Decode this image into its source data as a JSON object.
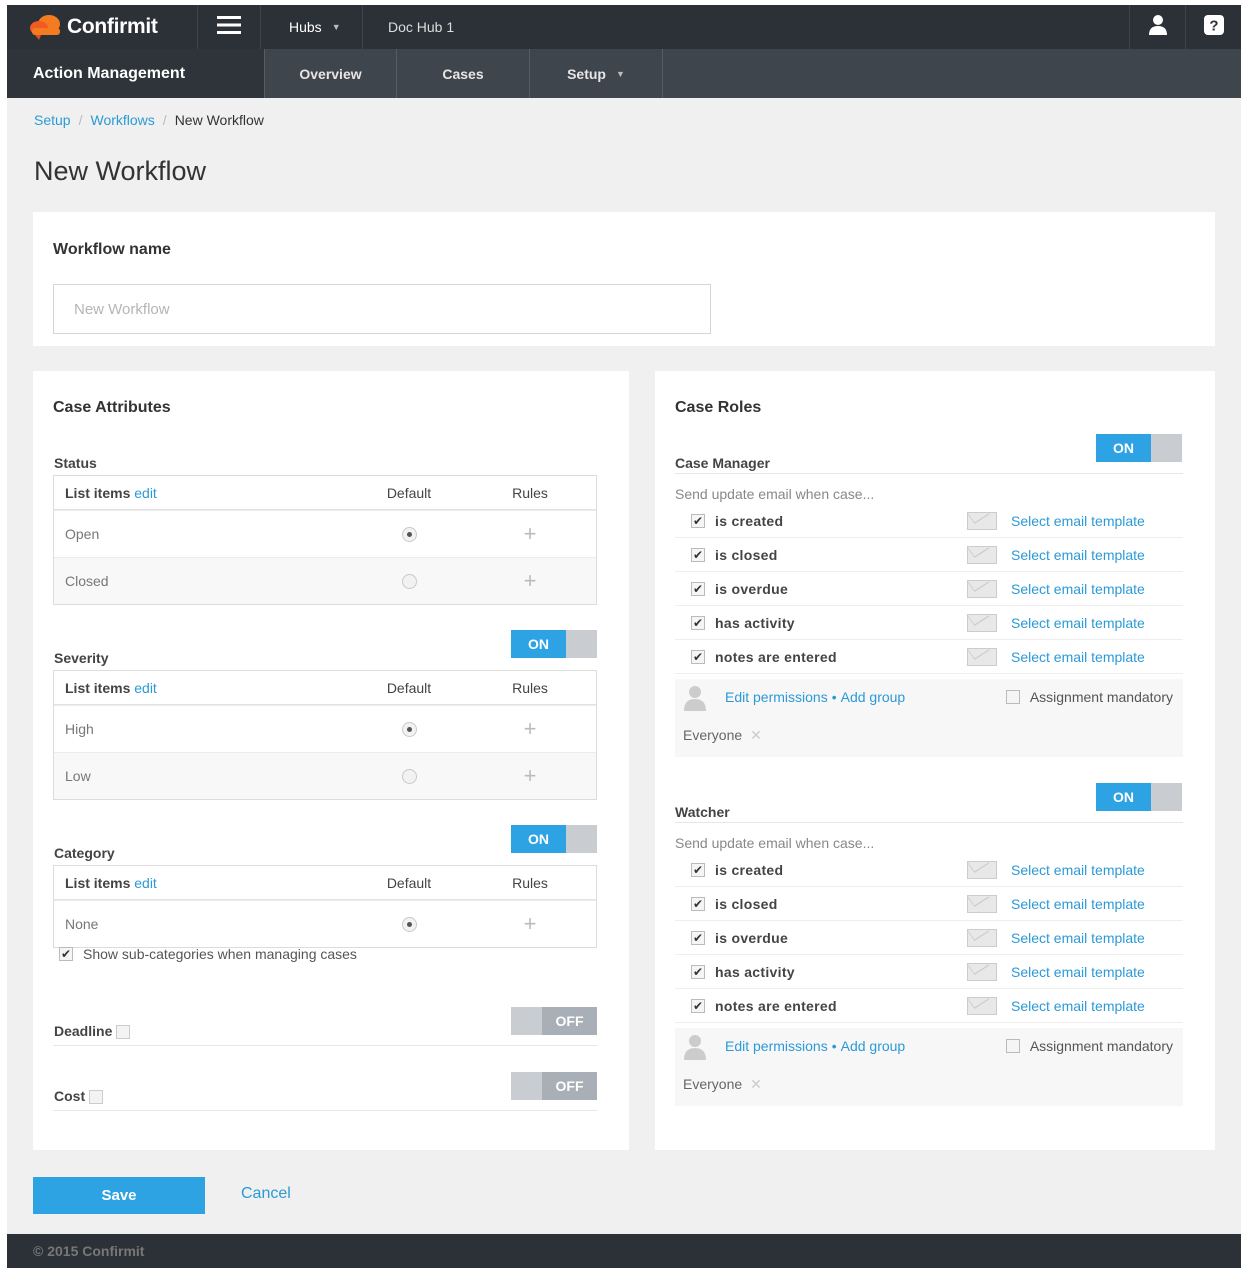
{
  "header": {
    "brand": "Confirmit",
    "hubs_label": "Hubs",
    "hub_name": "Doc Hub 1"
  },
  "subnav": {
    "title": "Action Management",
    "tabs": [
      {
        "label": "Overview"
      },
      {
        "label": "Cases"
      },
      {
        "label": "Setup"
      }
    ]
  },
  "breadcrumb": [
    "Setup",
    "Workflows",
    "New Workflow"
  ],
  "page_title": "New Workflow",
  "workflow_name": {
    "label": "Workflow name",
    "placeholder": "New Workflow",
    "value": ""
  },
  "case_attributes": {
    "title": "Case Attributes",
    "table_headers": {
      "list_items": "List items",
      "edit": "edit",
      "default": "Default",
      "rules": "Rules"
    },
    "status": {
      "label": "Status",
      "rows": [
        {
          "name": "Open",
          "default": true
        },
        {
          "name": "Closed",
          "default": false
        }
      ]
    },
    "severity": {
      "label": "Severity",
      "toggle": "ON",
      "rows": [
        {
          "name": "High",
          "default": true
        },
        {
          "name": "Low",
          "default": false
        }
      ]
    },
    "category": {
      "label": "Category",
      "toggle": "ON",
      "rows": [
        {
          "name": "None",
          "default": true
        }
      ],
      "subcategories_label": "Show sub-categories when managing cases",
      "subcategories_checked": true
    },
    "deadline": {
      "label": "Deadline",
      "toggle": "OFF"
    },
    "cost": {
      "label": "Cost",
      "toggle": "OFF"
    }
  },
  "case_roles": {
    "title": "Case Roles",
    "send_update": "Send update email when case...",
    "select_template": "Select email template",
    "edit_permissions": "Edit permissions",
    "add_group": "Add group",
    "assignment_mandatory": "Assignment mandatory",
    "everyone": "Everyone",
    "events": [
      "is created",
      "is closed",
      "is overdue",
      "has activity",
      "notes are entered"
    ],
    "roles": [
      {
        "name": "Case Manager",
        "toggle": "ON"
      },
      {
        "name": "Watcher",
        "toggle": "ON"
      }
    ]
  },
  "actions": {
    "save": "Save",
    "cancel": "Cancel"
  },
  "footer": "© 2015 Confirmit",
  "colors": {
    "accent": "#2ea3e4",
    "topbar": "#2c3137",
    "link": "#2b9ad6"
  }
}
